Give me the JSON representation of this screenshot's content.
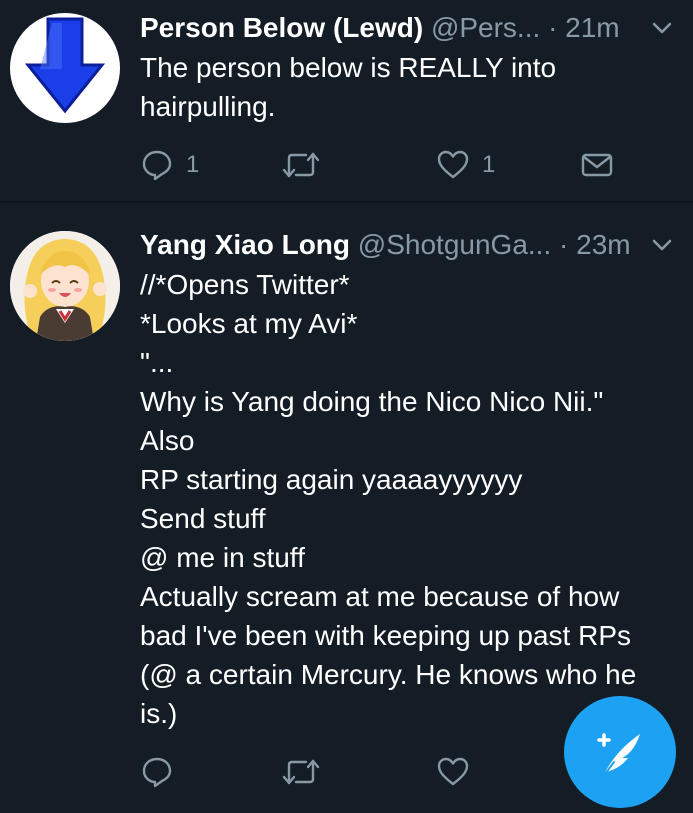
{
  "tweets": [
    {
      "name": "Person Below (Lewd)",
      "handle": "@Pers...",
      "time": "· 21m",
      "lines": [
        "The person below is REALLY into",
        "hairpulling."
      ],
      "actions": {
        "reply_count": "1",
        "retweet_count": "",
        "like_count": "1"
      },
      "avatar_icon": "blue-down-arrow-icon"
    },
    {
      "name": "Yang Xiao Long",
      "handle": "@ShotgunGa...",
      "time": "· 23m",
      "lines": [
        "//*Opens Twitter*",
        "*Looks at my Avi*",
        "\"...",
        "Why is Yang doing the Nico Nico Nii.\"",
        "Also",
        "RP starting again yaaaayyyyyy",
        "Send stuff",
        "@ me in stuff",
        "Actually scream at me because of how",
        "bad I've been with keeping up past RPs",
        "(@ a certain Mercury. He knows who he",
        "is.)"
      ],
      "actions": {
        "reply_count": "",
        "retweet_count": "",
        "like_count": ""
      },
      "avatar_icon": "anime-avatar"
    }
  ],
  "colors": {
    "background": "#141d26",
    "secondary_text": "#8899a6",
    "accent": "#1da1f2",
    "arrow_blue": "#1a3ee8"
  },
  "compose_button": {
    "icon": "compose-feather-icon"
  }
}
